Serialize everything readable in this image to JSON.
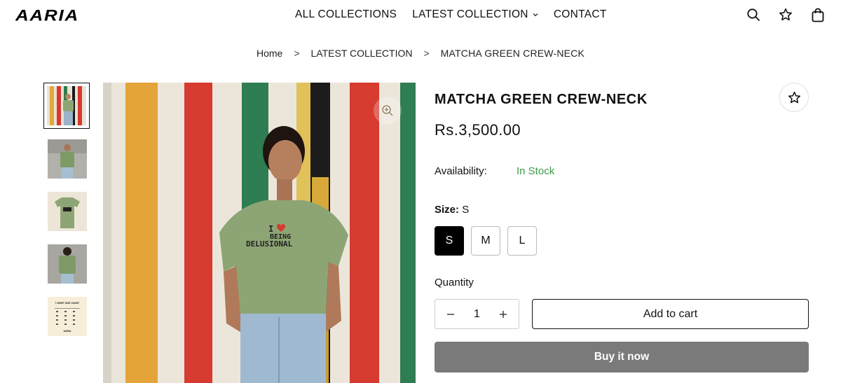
{
  "header": {
    "logo_text": "AARIA",
    "nav": [
      {
        "label": "ALL COLLECTIONS",
        "has_dropdown": false
      },
      {
        "label": "LATEST COLLECTION",
        "has_dropdown": true
      },
      {
        "label": "CONTACT",
        "has_dropdown": false
      }
    ],
    "icons": [
      "search-icon",
      "star-icon",
      "bag-icon"
    ]
  },
  "breadcrumb": {
    "items": [
      "Home",
      "LATEST COLLECTION",
      "MATCHA GREEN CREW-NECK"
    ],
    "separator": ">"
  },
  "gallery": {
    "thumbnail_count": 5,
    "active_index": 0,
    "thumbnails": [
      "model-front-stripes",
      "model-front-grey",
      "tshirt-flat-front",
      "model-back",
      "size-chart"
    ],
    "size_chart_title": "T-SHIRT SIZE CHART",
    "main_image": "model-front-stripes",
    "print_text": [
      "I",
      "BEING",
      "DELUSIONAL"
    ]
  },
  "product": {
    "title": "MATCHA GREEN CREW-NECK",
    "price": "Rs.3,500.00",
    "availability_label": "Availability:",
    "availability_value": "In Stock",
    "size_label": "Size:",
    "size_selected": "S",
    "sizes": [
      "S",
      "M",
      "L"
    ],
    "quantity_label": "Quantity",
    "quantity_value": "1",
    "add_to_cart": "Add to cart",
    "buy_now": "Buy it now"
  },
  "colors": {
    "in_stock": "#3c9a4a",
    "buy_now_bg": "#7a7a7a",
    "selected_size_bg": "#000000",
    "shirt_green": "#8da574"
  }
}
